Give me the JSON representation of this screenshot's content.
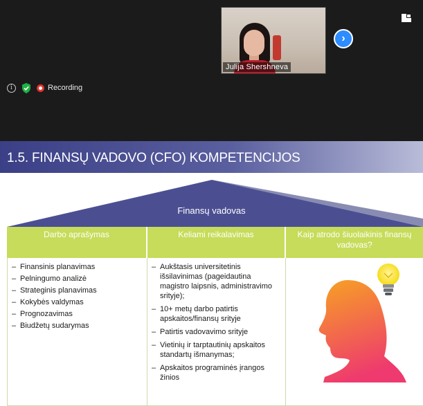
{
  "meeting": {
    "participant_name": "Julija Shershneva",
    "recording_label": "Recording",
    "icons": [
      "info-icon",
      "shield-check-icon",
      "recording-icon",
      "next-page-icon",
      "view-toggle-icon"
    ],
    "colors": {
      "background": "#1b1b1b",
      "accent": "#2d8cff",
      "recording": "#e0342d"
    }
  },
  "slide": {
    "title": "1.5. FINANSŲ VADOVO (CFO) KOMPETENCIJOS",
    "roof_label": "Finansų vadovas",
    "columns": [
      {
        "header": "Darbo aprašymas",
        "items": [
          "Finansinis planavimas",
          "Pelningumo analizė",
          "Strateginis planavimas",
          "Kokybės valdymas",
          "Prognozavimas",
          "Biudžetų sudarymas"
        ]
      },
      {
        "header": "Keliami reikalavimas",
        "items": [
          "Aukštasis universitetinis išsilavinimas (pageidautina magistro laipsnis, administravimo srityje);",
          "10+ metų darbo patirtis apskaitos/finansų srityje",
          "Patirtis vadovavimo srityje",
          "Vietinių ir tarptautinių apskaitos standartų išmanymas;",
          "Apskaitos programinės įrangos žinios"
        ]
      },
      {
        "header": "Kaip atrodo šiuolaikinis finansų vadovas?",
        "illustration": "head-with-lightbulb-icon"
      }
    ],
    "colors": {
      "title_bar": "#3b3f86",
      "roof": "#4b4f92",
      "header_row": "#c6dc5a",
      "head_gradient_top": "#f7a223",
      "head_gradient_bottom": "#ee3a6e",
      "bulb": "#f7dc1e"
    }
  }
}
